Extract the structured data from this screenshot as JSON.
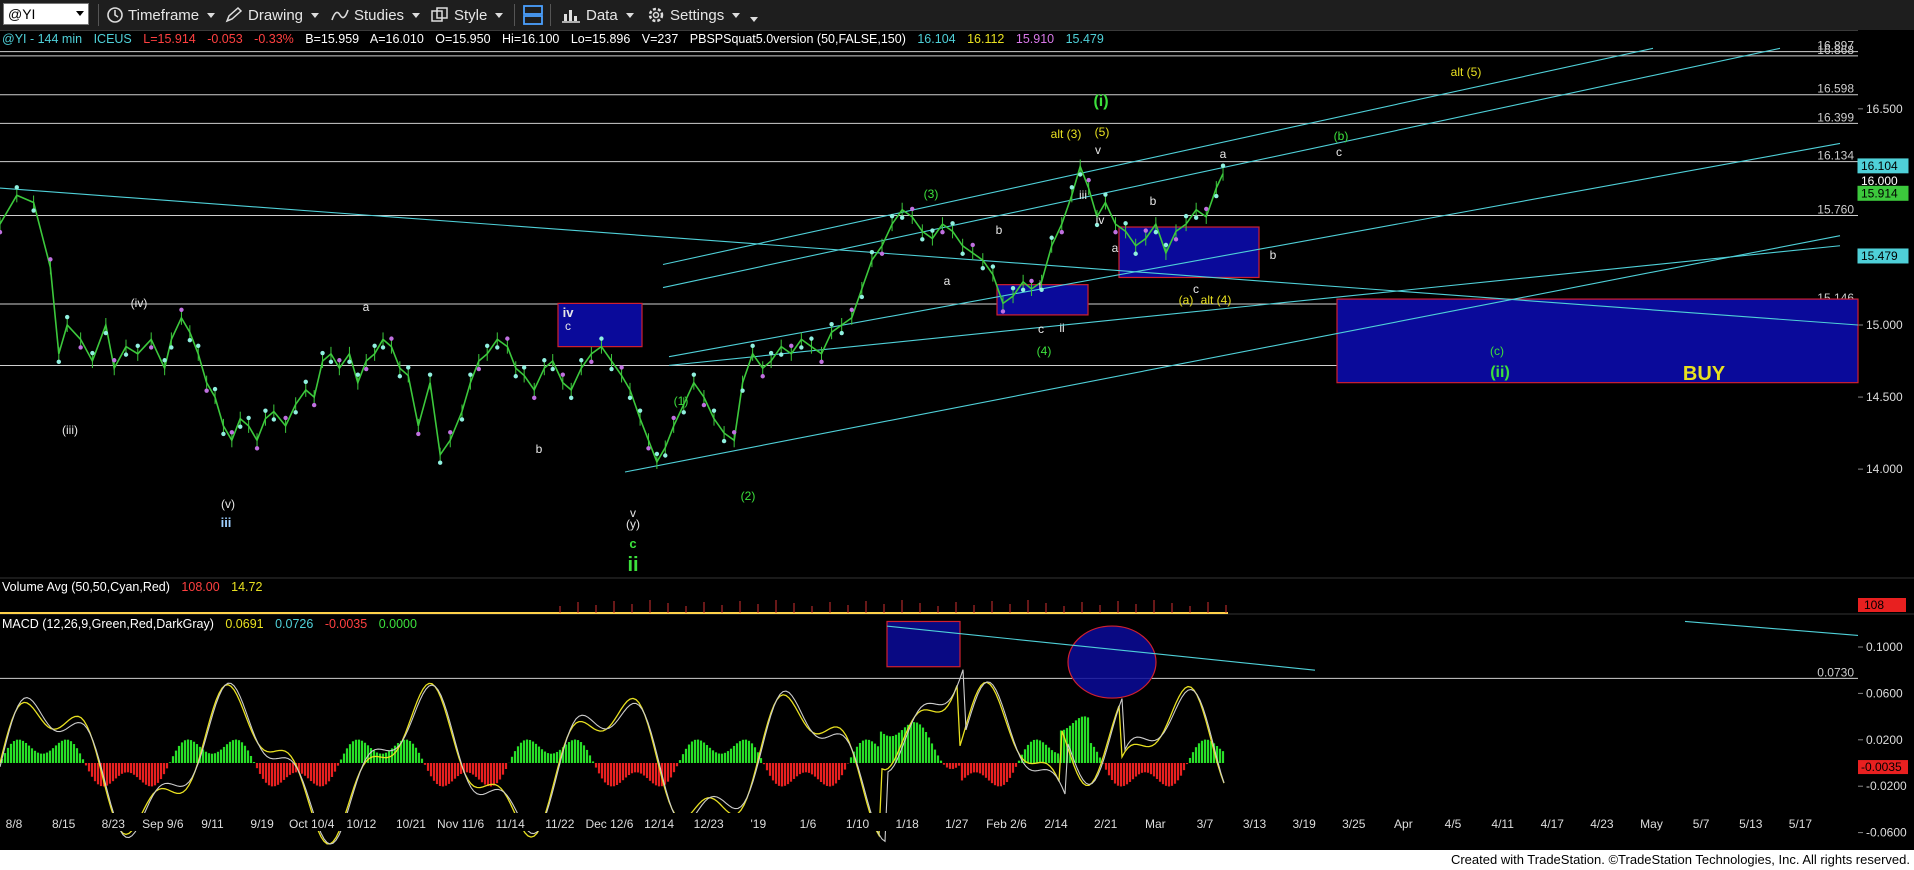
{
  "toolbar": {
    "symbol": "@YI",
    "timeframe": "Timeframe",
    "drawing": "Drawing",
    "studies": "Studies",
    "style": "Style",
    "data": "Data",
    "settings": "Settings"
  },
  "info": {
    "symbol_line": "@YI - 144 min",
    "exchange": "ICEUS",
    "last": "L=15.914",
    "change": "-0.053",
    "pct": "-0.33%",
    "bid": "B=15.959",
    "ask": "A=16.010",
    "open": "O=15.950",
    "high": "Hi=16.100",
    "low": "Lo=15.896",
    "volume": "V=237",
    "indicator": "PBSPSquat5.0version (50,FALSE,150)",
    "ind_v1": "16.104",
    "ind_v2": "16.112",
    "ind_v3": "15.910",
    "ind_v4": "15.479"
  },
  "volume_legend": {
    "label": "Volume Avg (50,50,Cyan,Red)",
    "v1": "108.00",
    "v2": "14.72"
  },
  "macd_legend": {
    "label": "MACD (12,26,9,Green,Red,DarkGray)",
    "v1": "0.0691",
    "v2": "0.0726",
    "v3": "-0.0035",
    "v4": "0.0000"
  },
  "footer": "Created with TradeStation. ©TradeStation Technologies, Inc. All rights reserved.",
  "colors": {
    "candle": "#3cc83c",
    "cyan": "#4fd0d8",
    "blue_box": "#0a0a9a",
    "box_border": "#d02030",
    "yellow": "#e8e020",
    "green_label": "#3ce03c",
    "macd_pos": "#28e028",
    "macd_neg": "#e82020"
  },
  "chart_data": {
    "type": "candlestick",
    "price_axis": {
      "ticks": [
        16.5,
        16.0,
        15.5,
        15.0,
        14.5,
        14.0
      ],
      "tick_labels": [
        "16.500",
        "16.000",
        "15.500",
        "15.000",
        "14.500",
        "14.000"
      ],
      "range": [
        13.3,
        16.95
      ]
    },
    "horizontal_levels": [
      {
        "value": 16.897,
        "label": "16.897"
      },
      {
        "value": 16.868,
        "label": "16.868"
      },
      {
        "value": 16.598,
        "label": "16.598"
      },
      {
        "value": 16.399,
        "label": "16.399"
      },
      {
        "value": 16.134,
        "label": "16.134"
      },
      {
        "value": 15.76,
        "label": "15.760"
      },
      {
        "value": 15.146,
        "label": "15.146"
      },
      {
        "value": 14.719,
        "label": "14.719"
      }
    ],
    "price_markers": [
      {
        "value": 16.104,
        "label": "16.104",
        "color": "#4fd0d8"
      },
      {
        "value": 16.0,
        "label": "16.000",
        "color": "#000000"
      },
      {
        "value": 15.914,
        "label": "15.914",
        "color": "#3cc83c"
      },
      {
        "value": 15.479,
        "label": "15.479",
        "color": "#4fd0d8"
      }
    ],
    "x_labels": [
      "8/8",
      "8/15",
      "8/23",
      "Sep 9/6",
      "9/11",
      "9/19",
      "Oct 10/4",
      "10/12",
      "10/21",
      "Nov 11/6",
      "11/14",
      "11/22",
      "Dec 12/6",
      "12/14",
      "12/23",
      "'19",
      "1/6",
      "1/10",
      "1/18",
      "1/27",
      "Feb 2/6",
      "2/14",
      "2/21",
      "Mar",
      "3/7",
      "3/13",
      "3/19",
      "3/25",
      "Apr",
      "4/5",
      "4/11",
      "4/17",
      "4/23",
      "May",
      "5/7",
      "5/13",
      "5/17"
    ],
    "price_path": [
      [
        0,
        15.7
      ],
      [
        10,
        15.9
      ],
      [
        20,
        15.85
      ],
      [
        30,
        15.4
      ],
      [
        35,
        14.8
      ],
      [
        40,
        15.0
      ],
      [
        48,
        14.9
      ],
      [
        55,
        14.75
      ],
      [
        63,
        15.0
      ],
      [
        68,
        14.7
      ],
      [
        75,
        14.85
      ],
      [
        82,
        14.8
      ],
      [
        90,
        14.9
      ],
      [
        98,
        14.7
      ],
      [
        102,
        14.9
      ],
      [
        108,
        15.05
      ],
      [
        113,
        14.95
      ],
      [
        118,
        14.8
      ],
      [
        123,
        14.6
      ],
      [
        128,
        14.5
      ],
      [
        133,
        14.3
      ],
      [
        138,
        14.2
      ],
      [
        143,
        14.35
      ],
      [
        148,
        14.3
      ],
      [
        153,
        14.2
      ],
      [
        158,
        14.35
      ],
      [
        163,
        14.4
      ],
      [
        170,
        14.3
      ],
      [
        176,
        14.45
      ],
      [
        182,
        14.55
      ],
      [
        187,
        14.5
      ],
      [
        192,
        14.75
      ],
      [
        197,
        14.8
      ],
      [
        202,
        14.7
      ],
      [
        208,
        14.8
      ],
      [
        213,
        14.6
      ],
      [
        218,
        14.75
      ],
      [
        223,
        14.8
      ],
      [
        228,
        14.9
      ],
      [
        233,
        14.85
      ],
      [
        238,
        14.7
      ],
      [
        243,
        14.65
      ],
      [
        249,
        14.3
      ],
      [
        256,
        14.6
      ],
      [
        262,
        14.1
      ],
      [
        268,
        14.2
      ],
      [
        275,
        14.4
      ],
      [
        280,
        14.6
      ],
      [
        285,
        14.75
      ],
      [
        290,
        14.8
      ],
      [
        296,
        14.9
      ],
      [
        302,
        14.85
      ],
      [
        307,
        14.7
      ],
      [
        312,
        14.65
      ],
      [
        318,
        14.55
      ],
      [
        324,
        14.7
      ],
      [
        329,
        14.75
      ],
      [
        335,
        14.6
      ],
      [
        340,
        14.55
      ],
      [
        346,
        14.7
      ],
      [
        352,
        14.8
      ],
      [
        358,
        14.85
      ],
      [
        364,
        14.75
      ],
      [
        370,
        14.65
      ],
      [
        375,
        14.55
      ],
      [
        381,
        14.35
      ],
      [
        386,
        14.2
      ],
      [
        391,
        14.05
      ],
      [
        396,
        14.15
      ],
      [
        401,
        14.3
      ],
      [
        407,
        14.45
      ],
      [
        413,
        14.6
      ],
      [
        419,
        14.5
      ],
      [
        425,
        14.35
      ],
      [
        431,
        14.25
      ],
      [
        437,
        14.2
      ],
      [
        442,
        14.6
      ],
      [
        448,
        14.8
      ],
      [
        454,
        14.7
      ],
      [
        459,
        14.75
      ],
      [
        465,
        14.85
      ],
      [
        471,
        14.8
      ],
      [
        477,
        14.9
      ],
      [
        483,
        14.85
      ],
      [
        489,
        14.8
      ],
      [
        495,
        14.95
      ],
      [
        501,
        15.0
      ],
      [
        507,
        15.05
      ],
      [
        513,
        15.25
      ],
      [
        519,
        15.45
      ],
      [
        525,
        15.55
      ],
      [
        531,
        15.7
      ],
      [
        537,
        15.8
      ],
      [
        543,
        15.75
      ],
      [
        549,
        15.65
      ],
      [
        555,
        15.6
      ],
      [
        561,
        15.7
      ],
      [
        567,
        15.65
      ],
      [
        573,
        15.55
      ],
      [
        579,
        15.5
      ],
      [
        585,
        15.45
      ],
      [
        591,
        15.35
      ],
      [
        597,
        15.15
      ],
      [
        603,
        15.2
      ],
      [
        609,
        15.3
      ],
      [
        614,
        15.25
      ],
      [
        620,
        15.3
      ],
      [
        626,
        15.55
      ],
      [
        632,
        15.7
      ],
      [
        638,
        15.9
      ],
      [
        643,
        16.1
      ],
      [
        648,
        15.95
      ],
      [
        653,
        15.75
      ],
      [
        658,
        15.85
      ],
      [
        664,
        15.7
      ],
      [
        670,
        15.65
      ],
      [
        676,
        15.55
      ],
      [
        682,
        15.6
      ],
      [
        688,
        15.7
      ],
      [
        694,
        15.5
      ],
      [
        700,
        15.65
      ],
      [
        706,
        15.7
      ],
      [
        712,
        15.8
      ],
      [
        718,
        15.75
      ],
      [
        724,
        15.95
      ],
      [
        728,
        16.05
      ]
    ],
    "panels": [
      "price",
      "volume",
      "macd"
    ],
    "macd_axis": {
      "ticks": [
        0.1,
        0.06,
        0.02,
        -0.02,
        -0.06
      ],
      "tick_labels": [
        "0.1000",
        "0.0600",
        "0.0200",
        "-0.0200",
        "-0.0600"
      ],
      "range": [
        -0.075,
        0.125
      ]
    },
    "macd_markers": [
      {
        "value": 0.073,
        "label": "0.0730"
      },
      {
        "value": -0.0035,
        "label": "-0.0035",
        "color": "#e82020"
      }
    ],
    "volume_marker": {
      "label": "108",
      "color": "#e82020"
    },
    "annotations": {
      "wave_labels_white": [
        "(iv)",
        "(iii)",
        "(v)",
        "a",
        "b",
        "c",
        "iv",
        "v",
        "(y)",
        "a",
        "b",
        "c",
        "i",
        "ii",
        "iii",
        "iv",
        "v",
        "a",
        "b",
        "c",
        "a",
        "b",
        "c"
      ],
      "wave_labels_green": [
        "(i)",
        "(5)",
        "(3)",
        "(1)",
        "(2)",
        "(4)",
        "(a)",
        "(b)",
        "(c)",
        "(ii)",
        "ii",
        "c",
        "b"
      ],
      "wave_labels_yellow": [
        "alt (3)",
        "alt (4)",
        "alt (5)",
        "BUY"
      ],
      "wave_labels_blue": [
        "iii"
      ]
    }
  }
}
